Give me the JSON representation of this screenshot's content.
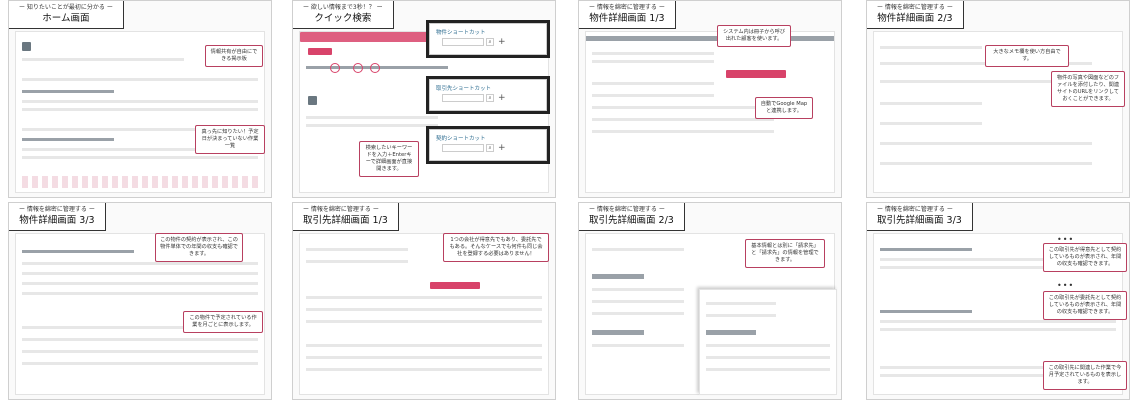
{
  "panels": [
    {
      "sub": "ー 知りたいことが最初に分かる ー",
      "title": "ホーム画面",
      "callouts": [
        "情報共有が自由にできる掲示板",
        "真っ先に知りたい！予定日が決まっていない作業一覧"
      ]
    },
    {
      "sub": "ー 欲しい情報まで3秒！？ ー",
      "title": "クイック検索",
      "callouts": [
        "検索したいキーワードを入力＋Enterキーで詳細画面が直接開きます。"
      ],
      "search": [
        "物件ショートカット",
        "取引先ショートカット",
        "契約ショートカット"
      ],
      "placeholder": "物件コード/名前"
    },
    {
      "sub": "ー 情報を綿密に管理する ー",
      "title": "物件詳細画面 1/3",
      "callouts": [
        "システム内は冊子から呼び出れた顧客を使います。",
        "自動でGoogle Mapと連携します。"
      ]
    },
    {
      "sub": "ー 情報を綿密に管理する ー",
      "title": "物件詳細画面 2/3",
      "callouts": [
        "大きなメモ欄を使い方自由です。",
        "物件の写真や図面などのファイルを添付したり、関連サイトのURLをリンクしておくことができます。"
      ]
    },
    {
      "sub": "ー 情報を綿密に管理する ー",
      "title": "物件詳細画面 3/3",
      "callouts": [
        "この物件の契約が表示され、この物件単体での年間の収支も確認できます。",
        "この物件で予定されている作業を月ごとに表示します。"
      ]
    },
    {
      "sub": "ー 情報を綿密に管理する ー",
      "title": "取引先詳細画面 1/3",
      "callouts": [
        "1つの会社が得意先でもあり、委託先でもある。そんなケースでも何件も同じ会社を登録する必要はありません！"
      ]
    },
    {
      "sub": "ー 情報を綿密に管理する ー",
      "title": "取引先詳細画面 2/3",
      "callouts": [
        "基本情報とは別に「請求先」と「請求先」の情報を管理できます。"
      ]
    },
    {
      "sub": "ー 情報を綿密に管理する ー",
      "title": "取引先詳細画面 3/3",
      "callouts": [
        "この取引先が得意先として契約しているものが表示され、年間の収支も確認できます。",
        "この取引先が委託先として契約しているものが表示され、年間の収支も確認できます。",
        "この取引先に関連した作業で今月予定されているものを表示します。"
      ]
    }
  ],
  "colors": {
    "accent": "#d8436a",
    "link": "#2b6b8f"
  }
}
